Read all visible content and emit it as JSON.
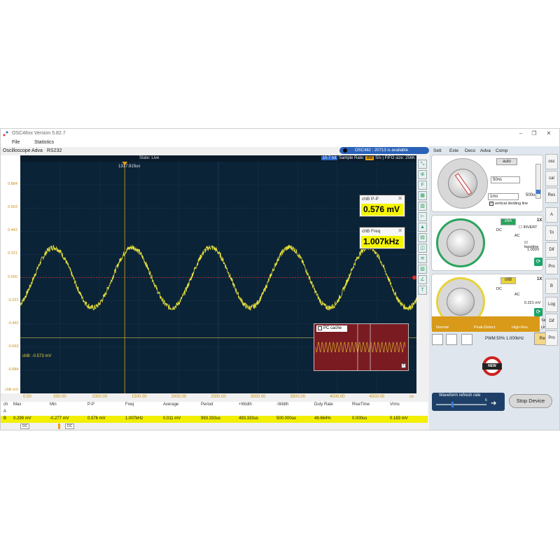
{
  "window": {
    "title": "OSC48xx  Version 5.82.7"
  },
  "menu": {
    "file": "File",
    "statistics": "Statistics"
  },
  "tabs": [
    "Oscilloscope",
    "Adva",
    "RS232"
  ],
  "status_pill": "OSC482 : 20713 is available",
  "scope": {
    "state": "State: Live",
    "bits": "10.7 bit",
    "sample_rate_label": "Sample Rate:",
    "sample_rate_value": "8M",
    "sample_rate_unit": "S/s",
    "fifo": "FIFO size: 256K",
    "cursor_time": "1317.915us",
    "y_ticks": [
      "0.884",
      "0.663",
      "0.442",
      "0.221",
      "0.000",
      "-0.221",
      "-0.442",
      "-0.663",
      "-0.884"
    ],
    "x_ticks": [
      "0.00",
      "500.00",
      "1000.00",
      "1500.00",
      "2000.00",
      "2500.00",
      "3000.00",
      "3500.00",
      "4000.00",
      "4500.00"
    ],
    "x_unit": "us",
    "chb_label": "chB: -0.573  mV",
    "axis_name": "chB  mV",
    "trace_color": "#e8e23a",
    "background": "#0b2337",
    "wave": {
      "amplitude_mv": 0.288,
      "period_us": 993.333,
      "offset_mv": 0.011
    },
    "ppbox": {
      "title": "chB P-P",
      "value": "0.576 mV"
    },
    "freqbox": {
      "title": "chB Freq",
      "value": "1.007kHz"
    },
    "pc_cache": "PC cache",
    "tools": [
      "⤡",
      "⊕",
      "F",
      "▦",
      "▥",
      "⊢",
      "▲",
      "▤",
      "◫",
      "≋",
      "▨",
      "∠",
      "T"
    ]
  },
  "table": {
    "headers": [
      "ch",
      "Max",
      "Min",
      "P-P",
      "Freq",
      "Average",
      "Period",
      "+Width",
      "-Width",
      "Duty Rate",
      "RiseTime",
      "Vrms"
    ],
    "rowA": "A",
    "rowB": [
      "B",
      "0.299 mV",
      "-0.277 mV",
      "0.576 mV",
      "1.007kHz",
      "0.011 mV",
      "993.333us",
      "493.333us",
      "500.000us",
      "49.664%",
      "0.000us",
      "0.183 mV"
    ],
    "dc1": "DC",
    "dc2": "DC"
  },
  "right": {
    "tabs": [
      "Sett",
      "Exte",
      "Deco",
      "Adva",
      "Comp"
    ],
    "auto": "auto",
    "timebase": "50ns",
    "time2": "1ms",
    "time3": "500us",
    "vdiv": "vertical dividing line",
    "cha": "chA",
    "chb": "chB",
    "x1a": "1X",
    "x1b": "1X",
    "invert": "INVERT",
    "dc": "DC",
    "ac": "AC",
    "baseline": "baseline",
    "baseline_v": "1.000V",
    "voltage": "0.221 mV",
    "modes": [
      "Normal",
      "Peak-Detect",
      "High-Res"
    ],
    "sine": "Sine",
    "linear": "Linear",
    "pwm": "PWM:50% 1.000kHz",
    "reset": "Reset",
    "refresh": "Waveform refresh rate",
    "refresh_val": "6",
    "stop": "Stop Device",
    "new_badge": "NEW",
    "side_buttons": [
      "osc",
      "cal",
      "Res",
      "A",
      "Tri",
      "Dif",
      "Pro",
      "B",
      "Log",
      "Dif",
      "Pro"
    ]
  }
}
